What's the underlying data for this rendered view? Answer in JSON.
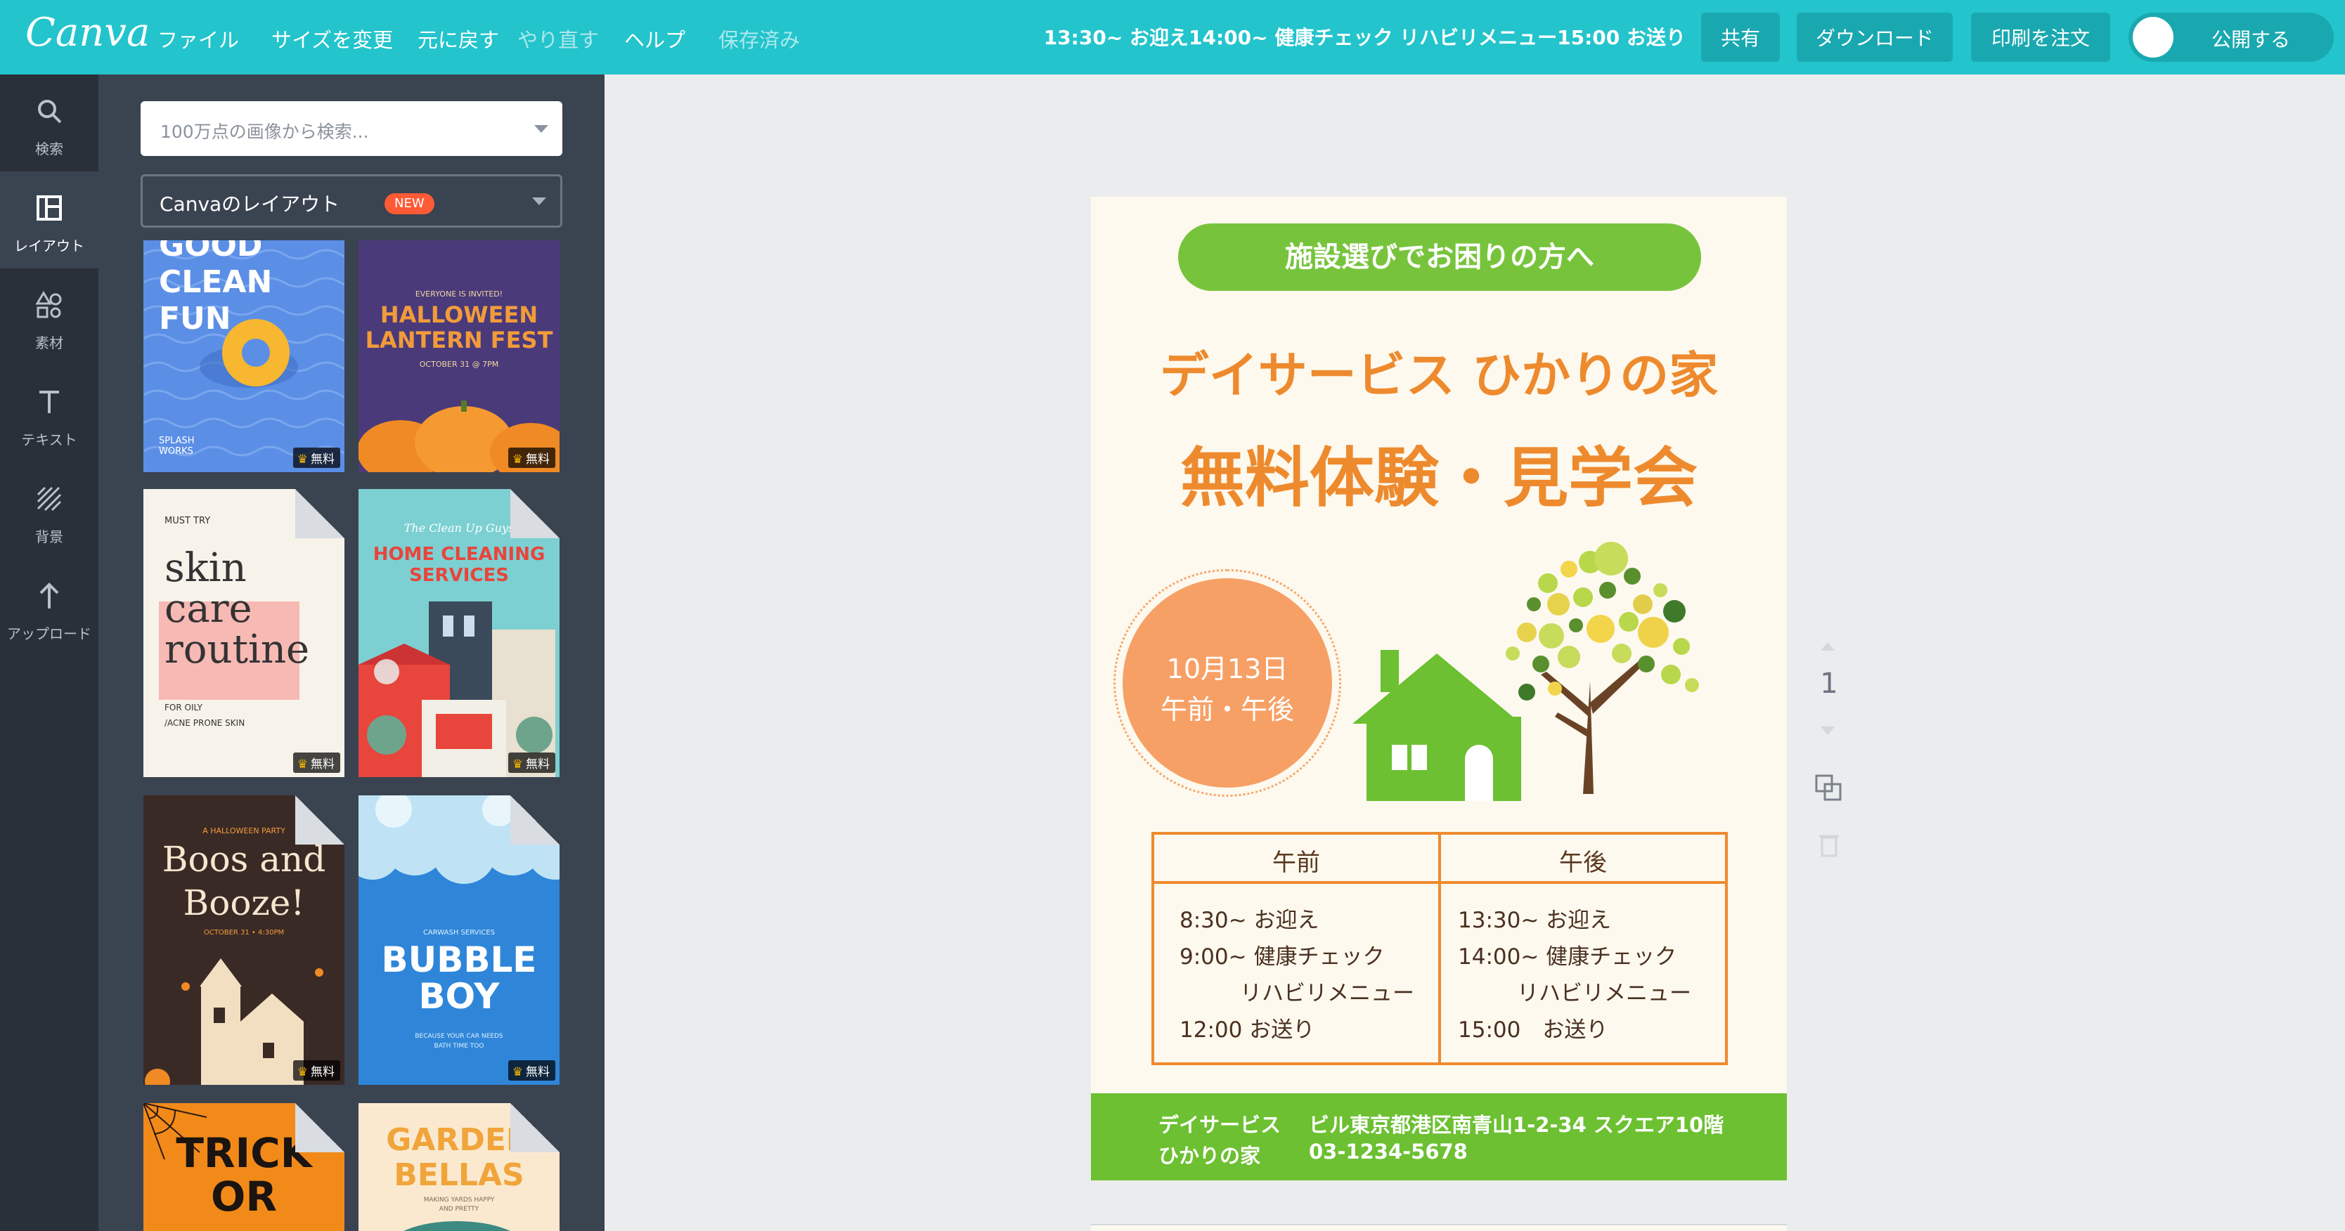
{
  "app": {
    "logo": "Canva",
    "menu": [
      "ファイル",
      "サイズを変更",
      "元に戻す",
      "やり直す",
      "ヘルプ"
    ],
    "saved_status": "保存済み",
    "title": "13:30~ お迎え14:00~ 健康チェック リハビリメニュー15:00 お送り",
    "share_label": "共有",
    "download_label": "ダウンロード",
    "print_label": "印刷を注文",
    "publish_label": "公開する"
  },
  "rail": {
    "items": [
      {
        "label": "検索",
        "icon": "search-icon"
      },
      {
        "label": "レイアウト",
        "icon": "layout-icon"
      },
      {
        "label": "素材",
        "icon": "elements-icon"
      },
      {
        "label": "テキスト",
        "icon": "text-icon"
      },
      {
        "label": "背景",
        "icon": "background-icon"
      },
      {
        "label": "アップロード",
        "icon": "upload-icon"
      }
    ]
  },
  "panel": {
    "search_placeholder": "100万点の画像から検索...",
    "layout_select": "Canvaのレイアウト",
    "new_badge": "NEW",
    "free_label": "無料",
    "templates": [
      {
        "lines": [
          "GOOD",
          "CLEAN",
          "FUN"
        ],
        "small": "SPLASH WORKS"
      },
      {
        "lines": [
          "HALLOWEEN",
          "LANTERN FEST"
        ],
        "small": "EVERYONE IS INVITED!",
        "small2": "OCTOBER 31 @ 7PM"
      },
      {
        "lines": [
          "skin",
          "care",
          "routine"
        ],
        "small": "MUST TRY",
        "small2": "FOR OILY",
        "small3": "/ACNE PRONE SKIN"
      },
      {
        "lines": [
          "HOME CLEANING",
          "SERVICES"
        ],
        "small": "The Clean Up Guys"
      },
      {
        "lines": [
          "Boos and",
          "Booze!"
        ],
        "small": "A HALLOWEEN PARTY",
        "small2": "OCTOBER 31 • 4:30PM"
      },
      {
        "lines": [
          "BUBBLE",
          "BOY"
        ],
        "small": "CARWASH SERVICES",
        "small2": "BECAUSE YOUR CAR NEEDS",
        "small3": "BATH TIME TOO"
      },
      {
        "lines": [
          "TRICK",
          "OR"
        ]
      },
      {
        "lines": [
          "GARDEN",
          "BELLAS"
        ],
        "small": "MAKING YARDS HAPPY",
        "small2": "AND PRETTY"
      }
    ]
  },
  "poster": {
    "pill": "施設選びでお困りの方へ",
    "title1": "デイサービス ひかりの家",
    "title2": "無料体験・見学会",
    "date_line1": "10月13日",
    "date_line2": "午前・午後",
    "schedule": {
      "am_header": "午前",
      "pm_header": "午後",
      "am": [
        "8:30~ お迎え",
        "9:00~ 健康チェック",
        "リハビリメニュー",
        "12:00 お送り"
      ],
      "pm": [
        "13:30~ お迎え",
        "14:00~ 健康チェック",
        "リハビリメニュー",
        "15:00　お送り"
      ]
    },
    "footer": {
      "name_line1": "デイサービス",
      "name_line2": "ひかりの家",
      "address": "ビル東京都港区南青山1-2-34 スクエア10階",
      "phone": "03-1234-5678"
    }
  },
  "page_controls": {
    "page_number": "1"
  },
  "colors": {
    "topbar": "#23c4cc",
    "rail": "#293039",
    "panel": "#3a4350",
    "poster_orange": "#ee8a2e",
    "poster_green": "#77c43c",
    "poster_bg": "#fdf9ee"
  }
}
